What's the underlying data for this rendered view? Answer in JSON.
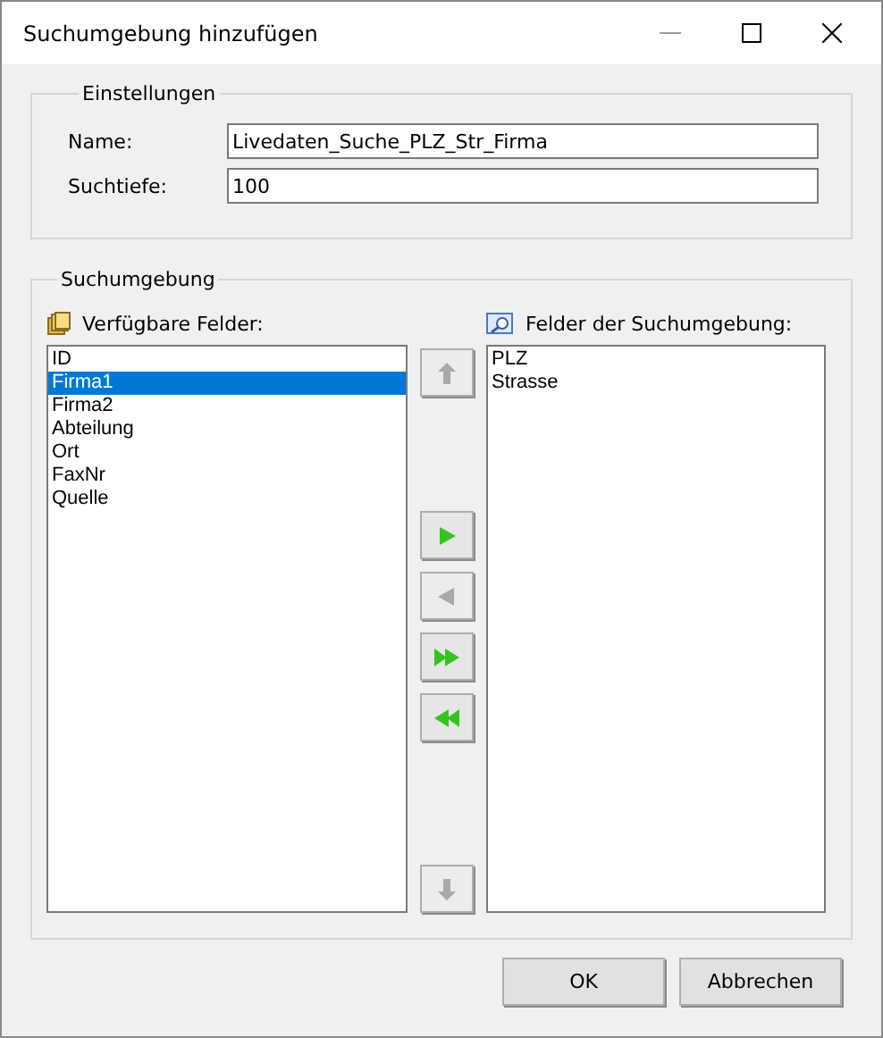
{
  "window": {
    "title": "Suchumgebung hinzufügen"
  },
  "settings": {
    "title": "Einstellungen",
    "fields": [
      {
        "label": "Name:",
        "value": "Livedaten_Suche_PLZ_Str_Firma"
      },
      {
        "label": "Suchtiefe:",
        "value": "100"
      }
    ]
  },
  "search_env": {
    "title": "Suchumgebung",
    "available": {
      "label": "Verfügbare Felder:",
      "items": [
        {
          "text": "ID",
          "selected": false
        },
        {
          "text": "Firma1",
          "selected": true
        },
        {
          "text": "Firma2",
          "selected": false
        },
        {
          "text": "Abteilung",
          "selected": false
        },
        {
          "text": "Ort",
          "selected": false
        },
        {
          "text": "FaxNr",
          "selected": false
        },
        {
          "text": "Quelle",
          "selected": false
        }
      ]
    },
    "move_buttons": [
      {
        "kind": "up",
        "disabled": true
      },
      {
        "kind": "add",
        "disabled": false
      },
      {
        "kind": "remove",
        "disabled": true
      },
      {
        "kind": "add_all",
        "disabled": false
      },
      {
        "kind": "remove_all",
        "disabled": false
      },
      {
        "kind": "down",
        "disabled": true
      }
    ],
    "chosen": {
      "label": "Felder der Suchumgebung:",
      "items": [
        {
          "text": "PLZ",
          "selected": false
        },
        {
          "text": "Strasse",
          "selected": false
        }
      ]
    }
  },
  "buttons": [
    "OK",
    "Abbrechen"
  ]
}
